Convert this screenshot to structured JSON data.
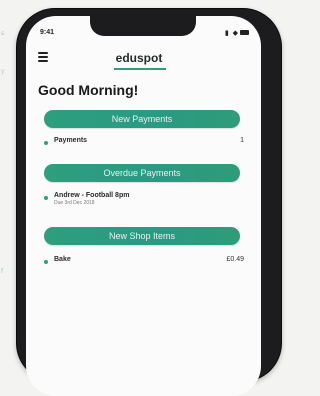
{
  "status_bar": {
    "time": "9:41",
    "icons": "▮ ◆"
  },
  "app": {
    "logo": "eduspot",
    "greeting": "Good Morning!"
  },
  "sections": [
    {
      "title": "New Payments",
      "rows": [
        {
          "label": "Payments",
          "value": "1"
        }
      ]
    },
    {
      "title": "Overdue Payments",
      "rows": [
        {
          "label": "Andrew - Football 8pm",
          "sub": "Due 3rd Dec 2018"
        }
      ]
    },
    {
      "title": "New Shop Items",
      "rows": [
        {
          "label": "Bake",
          "value": "£0.49"
        }
      ]
    }
  ],
  "background_text": [
    "s",
    "y",
    "f"
  ],
  "colors": {
    "accent": "#2d9f7d",
    "phone_frame": "#1c1c1f",
    "screen": "#fbfbfb"
  }
}
